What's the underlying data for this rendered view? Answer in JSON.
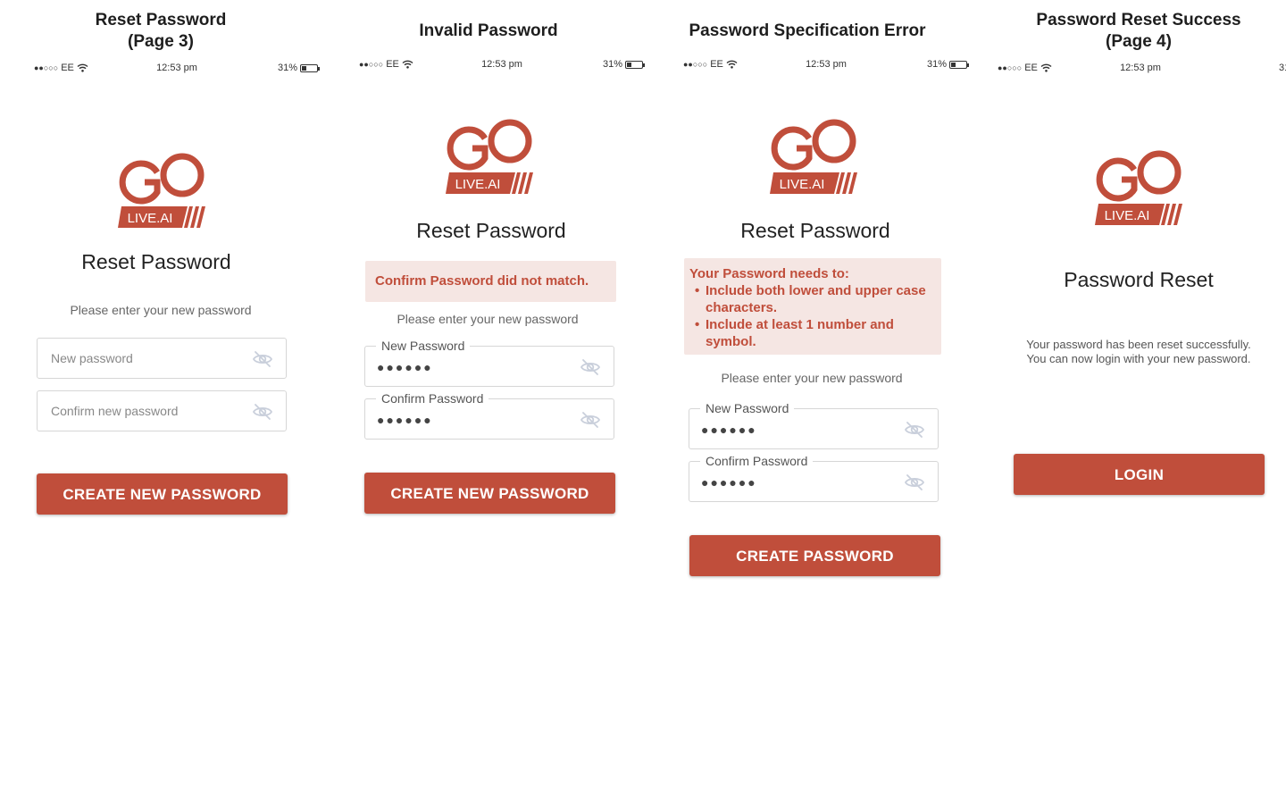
{
  "colors": {
    "accent": "#c04e3b",
    "alert_bg": "#f5e6e3"
  },
  "status_bar": {
    "carrier": "EE",
    "time": "12:53 pm",
    "battery": "31%",
    "battery_level": 0.31
  },
  "logo": {
    "text": "LIVE.AI"
  },
  "screens": [
    {
      "caption": "Reset Password\n(Page 3)",
      "title": "Reset Password",
      "hint": "Please enter your new password",
      "fields": [
        {
          "placeholder": "New password"
        },
        {
          "placeholder": "Confirm new password"
        }
      ],
      "button": "CREATE NEW PASSWORD"
    },
    {
      "caption": "Invalid Password",
      "title": "Reset Password",
      "alert": "Confirm Password did not match.",
      "hint": "Please enter your new password",
      "fields": [
        {
          "label": "New Password",
          "value": "●●●●●●"
        },
        {
          "label": "Confirm Password",
          "value": "●●●●●●"
        }
      ],
      "button": "CREATE NEW PASSWORD"
    },
    {
      "caption": "Password Specification Error",
      "title": "Reset Password",
      "alert_heading": "Your Password needs to:",
      "alert_items": [
        "Include both lower and upper case characters.",
        "Include at least 1 number and symbol."
      ],
      "hint": "Please enter your new password",
      "fields": [
        {
          "label": "New Password",
          "value": "●●●●●●"
        },
        {
          "label": "Confirm Password",
          "value": "●●●●●●"
        }
      ],
      "button": "CREATE PASSWORD"
    },
    {
      "caption": "Password Reset Success\n(Page 4)",
      "title": "Password Reset",
      "description": "Your password has been reset successfully. You can now login with your new password.",
      "button": "LOGIN"
    }
  ]
}
